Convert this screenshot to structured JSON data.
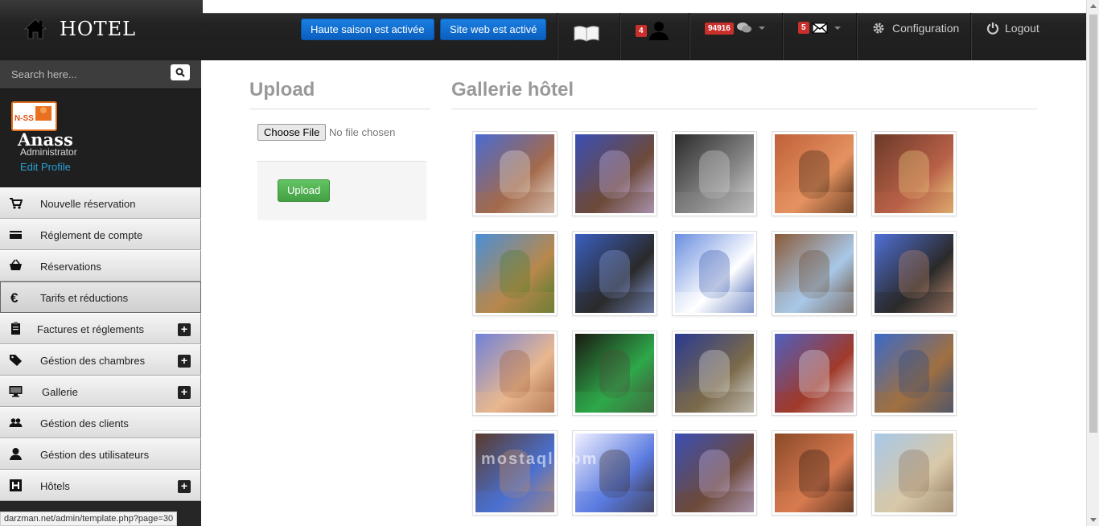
{
  "header": {
    "brand": "HOTEL",
    "high_season_button": "Haute saison est activée",
    "website_button": "Site web est activé",
    "users_badge": "4",
    "messages_badge": "94916",
    "mail_badge": "5",
    "config_label": "Configuration",
    "logout_label": "Logout"
  },
  "sidebar": {
    "search_placeholder": "Search here...",
    "profile": {
      "logo_text": "N-SS",
      "name": "Anass",
      "role": "Administrator",
      "edit_link": "Edit Profile"
    },
    "items": [
      {
        "label": "Nouvelle réservation",
        "icon": "cart-icon",
        "expandable": false,
        "active": false
      },
      {
        "label": "Réglement de compte",
        "icon": "credit-card-icon",
        "expandable": false,
        "active": false
      },
      {
        "label": "Réservations",
        "icon": "basket-icon",
        "expandable": false,
        "active": false
      },
      {
        "label": "Tarifs et réductions",
        "icon": "euro-icon",
        "expandable": false,
        "active": true
      },
      {
        "label": "Factures et réglements",
        "icon": "clipboard-icon",
        "expandable": true,
        "active": false
      },
      {
        "label": "Géstion des chambres",
        "icon": "tag-icon",
        "expandable": true,
        "active": false
      },
      {
        "label": "Gallerie",
        "icon": "monitor-icon",
        "expandable": true,
        "active": false
      },
      {
        "label": "Géstion des clients",
        "icon": "users-icon",
        "expandable": false,
        "active": false
      },
      {
        "label": "Géstion des utilisateurs",
        "icon": "user-icon",
        "expandable": false,
        "active": false
      },
      {
        "label": "Hôtels",
        "icon": "hotel-h-icon",
        "expandable": true,
        "active": false
      }
    ],
    "plus_symbol": "+"
  },
  "status_url": "darzman.net/admin/template.php?page=30",
  "upload": {
    "title": "Upload",
    "choose_file": "Choose File",
    "no_file": "No file chosen",
    "button": "Upload"
  },
  "gallery": {
    "title": "Gallerie hôtel",
    "images": [
      {
        "name": "fountain-tile",
        "colors": [
          "#4a6bd1",
          "#a36a4c",
          "#e8e0d5"
        ]
      },
      {
        "name": "blue-stairs",
        "colors": [
          "#3b4fb5",
          "#6d4a3a",
          "#c8b8e8"
        ]
      },
      {
        "name": "bw-alley",
        "colors": [
          "#2a2a2a",
          "#888888",
          "#d8d8d8"
        ]
      },
      {
        "name": "triangle-lamp",
        "colors": [
          "#c0603a",
          "#e59260",
          "#3a2210"
        ]
      },
      {
        "name": "wall-sconce",
        "colors": [
          "#6a3a28",
          "#b86048",
          "#f0d080"
        ]
      },
      {
        "name": "kasbah-tower",
        "colors": [
          "#4a8fd6",
          "#b8884c",
          "#4a7a2a"
        ]
      },
      {
        "name": "blue-balcony",
        "colors": [
          "#3b5fc0",
          "#2a2a2a",
          "#8aa0e0"
        ]
      },
      {
        "name": "blue-street",
        "colors": [
          "#6a8ee0",
          "#ffffff",
          "#3a5ab0"
        ]
      },
      {
        "name": "arch-terrace",
        "colors": [
          "#8a5a38",
          "#a8c8e8",
          "#6a4a30"
        ]
      },
      {
        "name": "blue-railing",
        "colors": [
          "#5070d8",
          "#2a2a2a",
          "#c08a70"
        ]
      },
      {
        "name": "arch-niche",
        "colors": [
          "#7080d8",
          "#e8b890",
          "#a06040"
        ]
      },
      {
        "name": "night-hotel",
        "colors": [
          "#1a1a12",
          "#2ea84a",
          "#4a4a3a"
        ]
      },
      {
        "name": "tiled-courtyard",
        "colors": [
          "#2a3a90",
          "#7a6a4a",
          "#e0e0e0"
        ]
      },
      {
        "name": "lounge-windows",
        "colors": [
          "#5060c0",
          "#a03a2a",
          "#e8e8f0"
        ]
      },
      {
        "name": "blue-salon",
        "colors": [
          "#3a6ac8",
          "#a07040",
          "#2a4a80"
        ]
      },
      {
        "name": "wooden-door",
        "colors": [
          "#5a3a2a",
          "#4a70d0",
          "#c89060"
        ]
      },
      {
        "name": "stairwell-light",
        "colors": [
          "#f0f0ff",
          "#5a7ae0",
          "#3a2a20"
        ]
      },
      {
        "name": "blue-stairs-2",
        "colors": [
          "#3b4fb5",
          "#6d4a3a",
          "#c8b8e8"
        ]
      },
      {
        "name": "wooden-ceiling",
        "colors": [
          "#8a4a28",
          "#d87a50",
          "#2a1a10"
        ]
      },
      {
        "name": "minaret-view",
        "colors": [
          "#a8c8e8",
          "#d8c8a8",
          "#8a7058"
        ]
      }
    ]
  },
  "watermark": "mostaql.com"
}
